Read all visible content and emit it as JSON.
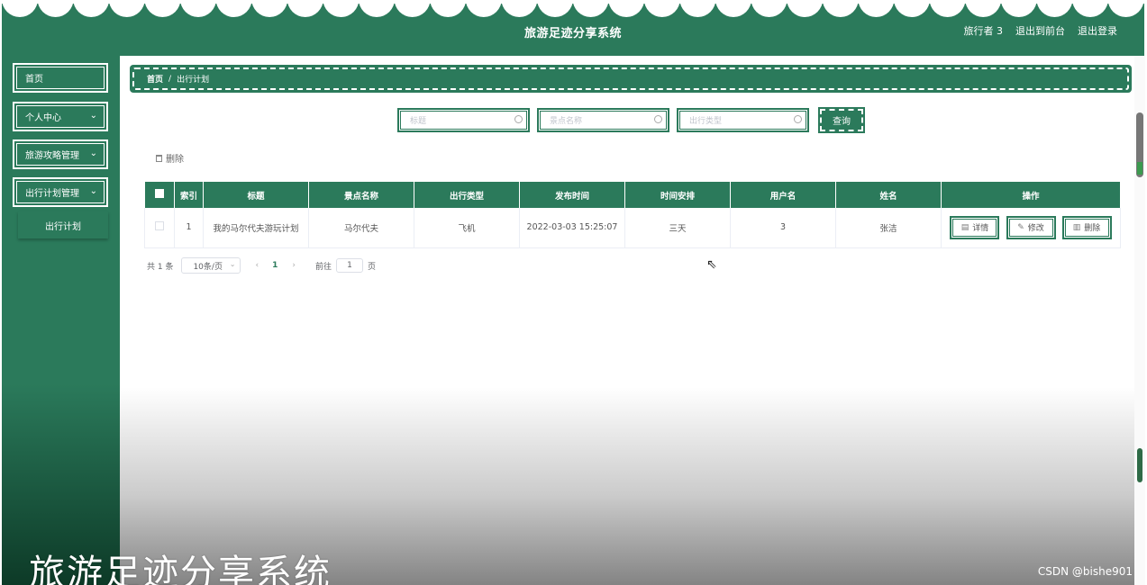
{
  "header": {
    "title": "旅游足迹分享系统",
    "user": "旅行者 3",
    "back_to_front": "退出到前台",
    "logout": "退出登录"
  },
  "sidebar": {
    "items": [
      {
        "label": "首页"
      },
      {
        "label": "个人中心"
      },
      {
        "label": "旅游攻略管理"
      },
      {
        "label": "出行计划管理"
      }
    ],
    "sub_items": [
      {
        "label": "出行计划"
      }
    ]
  },
  "breadcrumb": {
    "home": "首页",
    "separator": "/",
    "current": "出行计划"
  },
  "search": {
    "title_placeholder": "标题",
    "spot_placeholder": "景点名称",
    "type_placeholder": "出行类型",
    "button": "查询"
  },
  "bulk_delete": "删除",
  "table": {
    "headers": [
      "索引",
      "标题",
      "景点名称",
      "出行类型",
      "发布时间",
      "时间安排",
      "用户名",
      "姓名",
      "操作"
    ],
    "rows": [
      {
        "index": "1",
        "title": "我的马尔代夫游玩计划",
        "spot": "马尔代夫",
        "type": "飞机",
        "time": "2022-03-03 15:25:07",
        "schedule": "三天",
        "username": "3",
        "name": "张洁"
      }
    ],
    "actions": {
      "detail": "详情",
      "edit": "修改",
      "delete": "删除"
    }
  },
  "pagination": {
    "total": "共 1 条",
    "page_size": "10条/页",
    "current_page": "1",
    "goto_label": "前往",
    "goto_value": "1",
    "page_unit": "页"
  },
  "watermark": {
    "title": "旅游足迹分享系统",
    "csdn": "CSDN @bishe901"
  },
  "colors": {
    "primary": "#2b7a5b"
  }
}
